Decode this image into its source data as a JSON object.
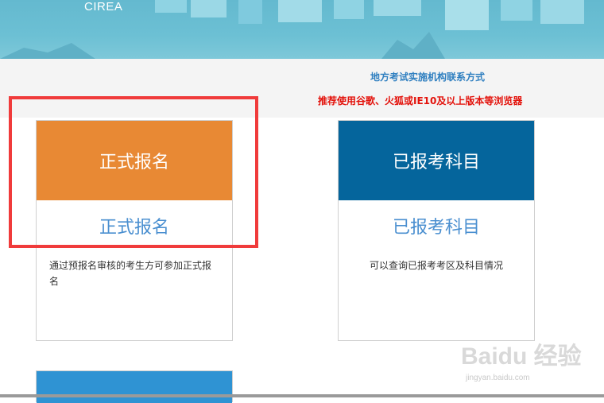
{
  "header": {
    "logo_text": "CIREA"
  },
  "notice": {
    "contact_link": "地方考试实施机构联系方式",
    "browser_tip": "推荐使用谷歌、火狐或IE10及以上版本等浏览器"
  },
  "cards": [
    {
      "head": "正式报名",
      "subtitle": "正式报名",
      "description": "通过预报名审核的考生方可参加正式报名",
      "color": "#e88934"
    },
    {
      "head": "已报考科目",
      "subtitle": "已报考科目",
      "description": "可以查询已报考考区及科目情况",
      "color": "#05659c"
    }
  ],
  "watermark": {
    "text": "Baidu 经验",
    "url_text": "jingyan.baidu.com"
  },
  "colors": {
    "banner": "#6cc0d4",
    "annotation": "#f03b3b",
    "link": "#2f7fc0",
    "tip": "#e3120b",
    "third_card": "#2f93d3"
  }
}
